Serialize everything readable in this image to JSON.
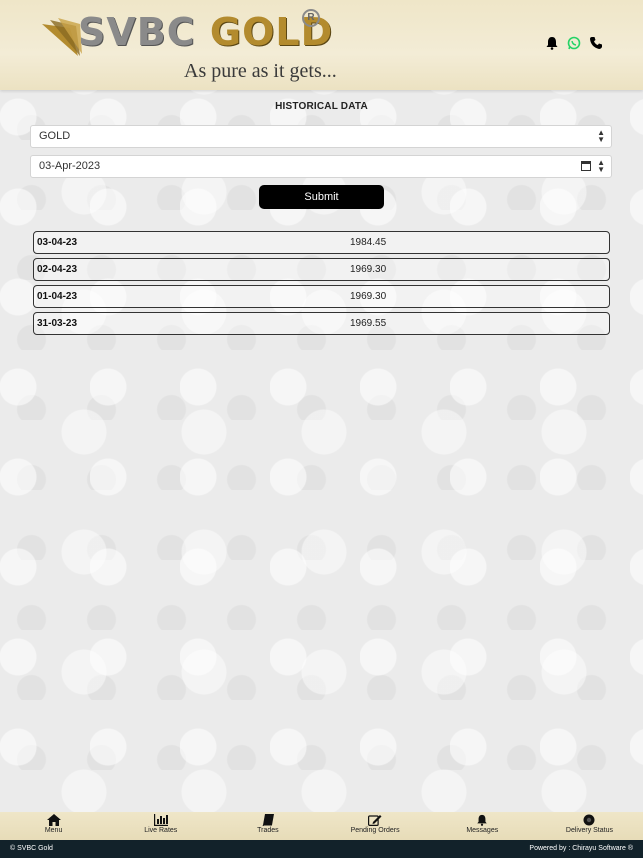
{
  "header": {
    "brand_main": "SVBC",
    "brand_accent": "GOLD",
    "registered": "R",
    "tagline": "As pure as it gets...",
    "icons": [
      "bell-icon",
      "whatsapp-icon",
      "phone-icon"
    ]
  },
  "page": {
    "title": "HISTORICAL DATA"
  },
  "form": {
    "commodity_value": "GOLD",
    "date_value": "03-Apr-2023",
    "submit_label": "Submit"
  },
  "rows": [
    {
      "date": "03-04-23",
      "value": "1984.45"
    },
    {
      "date": "02-04-23",
      "value": "1969.30"
    },
    {
      "date": "01-04-23",
      "value": "1969.30"
    },
    {
      "date": "31-03-23",
      "value": "1969.55"
    }
  ],
  "nav": [
    {
      "label": "Menu",
      "icon": "home-icon"
    },
    {
      "label": "Live Rates",
      "icon": "bar-chart-icon"
    },
    {
      "label": "Trades",
      "icon": "book-icon"
    },
    {
      "label": "Pending Orders",
      "icon": "edit-icon"
    },
    {
      "label": "Messages",
      "icon": "bell-icon"
    },
    {
      "label": "Delivery Status",
      "icon": "gear-icon"
    }
  ],
  "footer": {
    "copyright": "© SVBC Gold",
    "powered": "Powered by : Chirayu Software ®"
  },
  "colors": {
    "header_bg": "#efe6c8",
    "gold": "#b38b2e",
    "footer_bg": "#12222a",
    "whatsapp": "#25d366"
  }
}
